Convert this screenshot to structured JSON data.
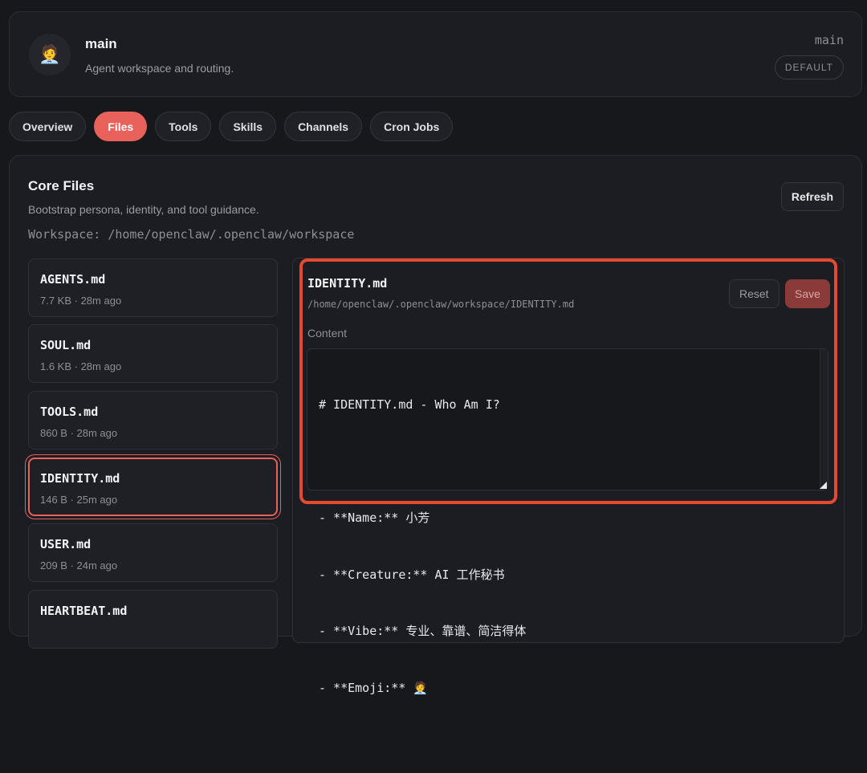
{
  "agent": {
    "avatar_emoji": "🧑‍💼",
    "name": "main",
    "description": "Agent workspace and routing.",
    "id": "main",
    "badge": "DEFAULT"
  },
  "tabs": [
    {
      "label": "Overview",
      "active": false
    },
    {
      "label": "Files",
      "active": true
    },
    {
      "label": "Tools",
      "active": false
    },
    {
      "label": "Skills",
      "active": false
    },
    {
      "label": "Channels",
      "active": false
    },
    {
      "label": "Cron Jobs",
      "active": false
    }
  ],
  "panel": {
    "title": "Core Files",
    "subtitle": "Bootstrap persona, identity, and tool guidance.",
    "workspace": "Workspace: /home/openclaw/.openclaw/workspace",
    "refresh_label": "Refresh"
  },
  "files": [
    {
      "name": "AGENTS.md",
      "meta": "7.7 KB · 28m ago",
      "selected": false
    },
    {
      "name": "SOUL.md",
      "meta": "1.6 KB · 28m ago",
      "selected": false
    },
    {
      "name": "TOOLS.md",
      "meta": "860 B · 28m ago",
      "selected": false
    },
    {
      "name": "IDENTITY.md",
      "meta": "146 B · 25m ago",
      "selected": true
    },
    {
      "name": "USER.md",
      "meta": "209 B · 24m ago",
      "selected": false
    },
    {
      "name": "HEARTBEAT.md",
      "meta": "",
      "selected": false
    }
  ],
  "editor": {
    "title": "IDENTITY.md",
    "path": "/home/openclaw/.openclaw/workspace/IDENTITY.md",
    "reset_label": "Reset",
    "save_label": "Save",
    "content_label": "Content",
    "content_lines": [
      "# IDENTITY.md - Who Am I?",
      "",
      "- **Name:** 小芳",
      "- **Creature:** AI 工作秘书",
      "- **Vibe:** 专业、靠谱、简洁得体",
      "- **Emoji:** 🧑‍💼"
    ]
  },
  "colors": {
    "accent": "#e8615a",
    "highlight": "#e5492f",
    "background": "#17181c",
    "card": "#1c1d22"
  }
}
